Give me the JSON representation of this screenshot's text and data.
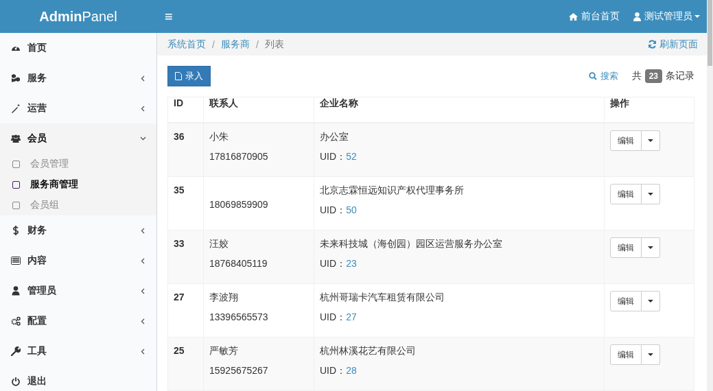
{
  "header": {
    "logo": "**Admin**Panel",
    "menu_toggle": "≡",
    "links": [
      {
        "kind": "home",
        "label": "前台首页"
      },
      {
        "kind": "user",
        "label": "测试管理员"
      }
    ]
  },
  "sidebar": {
    "items": [
      {
        "kind": "link",
        "label": "首页",
        "selected": false
      },
      {
        "kind": "menu",
        "label": "服务",
        "expanded": false,
        "selected": false
      },
      {
        "kind": "menu",
        "label": "运营",
        "expanded": false,
        "selected": false
      },
      {
        "kind": "menu",
        "label": "会员",
        "expanded": true,
        "selected": true,
        "children": [
          {
            "label": "会员管理",
            "selected": false
          },
          {
            "label": "服务商管理",
            "selected": true
          },
          {
            "label": "会员组",
            "selected": false
          }
        ]
      },
      {
        "kind": "menu",
        "label": "财务",
        "expanded": false,
        "selected": false
      },
      {
        "kind": "menu",
        "label": "内容",
        "expanded": false,
        "selected": false
      },
      {
        "kind": "menu",
        "label": "管理员",
        "expanded": false,
        "selected": false
      },
      {
        "kind": "menu",
        "label": "配置",
        "expanded": false,
        "selected": false
      },
      {
        "kind": "menu",
        "label": "工具",
        "expanded": false,
        "selected": false
      },
      {
        "kind": "link",
        "label": "退出",
        "selected": false
      }
    ]
  },
  "breadcrumb": {
    "items": [
      "系统首页",
      "服务商",
      "列表"
    ],
    "separator": "/",
    "refresh": "刷新页面"
  },
  "toolbar": {
    "add_button": "录入",
    "search": "搜索",
    "total_prefix": "共",
    "total": "23",
    "total_suffix": "条记录"
  },
  "table": {
    "columns": [
      "ID",
      "联系人",
      "企业名称",
      "操作"
    ],
    "rows": [
      {
        "id": "36",
        "contact": "小朱",
        "phone": "17816870905",
        "company": "办公室",
        "uid_label": "UID：",
        "uid": "52",
        "action": "编辑"
      },
      {
        "id": "35",
        "phone": "18069859909",
        "company": "北京志霖恒远知识产权代理事务所",
        "uid_label": "UID：",
        "uid": "50",
        "action": "编辑"
      },
      {
        "id": "33",
        "contact": "汪姣",
        "phone": "18768405119",
        "company": "未来科技城（海创园）园区运营服务办公室",
        "uid_label": "UID：",
        "uid": "23",
        "action": "编辑"
      },
      {
        "id": "27",
        "contact": "李波翔",
        "phone": "13396565573",
        "company": "杭州哥瑞卡汽车租赁有限公司",
        "uid_label": "UID：",
        "uid": "27",
        "action": "编辑"
      },
      {
        "id": "25",
        "contact": "严敏芳",
        "phone": "15925675267",
        "company": "杭州林溪花艺有限公司",
        "uid_label": "UID：",
        "uid": "28",
        "action": "编辑"
      }
    ]
  }
}
